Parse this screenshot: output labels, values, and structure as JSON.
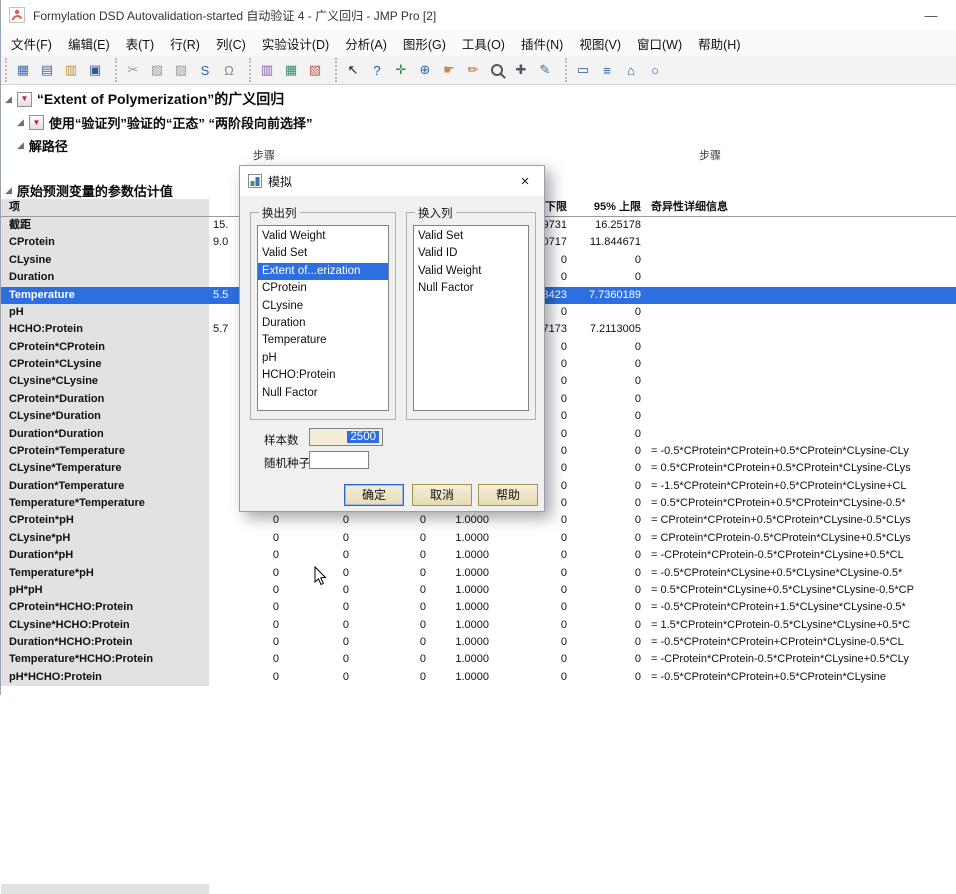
{
  "window": {
    "title": "Formylation DSD Autovalidation-started 自动验证 4 - 广义回归 - JMP Pro [2]",
    "controls": {
      "minimize": "—"
    }
  },
  "menu_bar": {
    "items": [
      "文件(F)",
      "编辑(E)",
      "表(T)",
      "行(R)",
      "列(C)",
      "实验设计(D)",
      "分析(A)",
      "图形(G)",
      "工具(O)",
      "插件(N)",
      "视图(V)",
      "窗口(W)",
      "帮助(H)"
    ]
  },
  "toolbar": {
    "groups": [
      [
        {
          "name": "new-data-table-icon",
          "glyph": "▦",
          "color": "#3f6fb5"
        },
        {
          "name": "new-journal-icon",
          "glyph": "▤",
          "color": "#3f6fb5"
        },
        {
          "name": "open-icon",
          "glyph": "▥",
          "color": "#c29336"
        },
        {
          "name": "save-icon",
          "glyph": "▣",
          "color": "#33568f"
        }
      ],
      [
        {
          "name": "cut-icon",
          "glyph": "✂",
          "color": "#9a9a9a"
        },
        {
          "name": "copy-icon",
          "glyph": "▧",
          "color": "#9a9a9a"
        },
        {
          "name": "paste-icon",
          "glyph": "▨",
          "color": "#9a9a9a"
        },
        {
          "name": "copy-special-icon",
          "glyph": "S",
          "color": "#2e62a8"
        },
        {
          "name": "lock-icon",
          "glyph": "Ω",
          "color": "#8a8a8a"
        }
      ],
      [
        {
          "name": "journal-icon",
          "glyph": "▥",
          "color": "#8b5ca8"
        },
        {
          "name": "layout-icon",
          "glyph": "▦",
          "color": "#2f8f6f"
        },
        {
          "name": "graph-builder-icon",
          "glyph": "▧",
          "color": "#c0574a"
        }
      ],
      [
        {
          "name": "arrow-cursor-icon",
          "glyph": "↖",
          "color": "#1a1a1a"
        },
        {
          "name": "help-tool-icon",
          "glyph": "?",
          "color": "#1b52b5"
        },
        {
          "name": "move-tool-icon",
          "glyph": "✛",
          "color": "#2a8a3a"
        },
        {
          "name": "globe-icon",
          "glyph": "⊕",
          "color": "#2a6ab0"
        },
        {
          "name": "grabber-hand-icon",
          "glyph": "☛",
          "color": "#c8894a"
        },
        {
          "name": "brush-icon",
          "glyph": "✏",
          "color": "#b06a2a"
        },
        {
          "name": "magnifier-icon",
          "glyph": "",
          "color": "#555",
          "cls": "magnifier"
        },
        {
          "name": "plus-icon",
          "glyph": "✚",
          "color": "#556"
        },
        {
          "name": "pencil-icon",
          "glyph": "✎",
          "color": "#2a6ab0"
        }
      ],
      [
        {
          "name": "rectangle-annotate-icon",
          "glyph": "▭",
          "color": "#2a5a9a"
        },
        {
          "name": "lines-annotate-icon",
          "glyph": "≡",
          "color": "#2a5a9a"
        },
        {
          "name": "polygon-annotate-icon",
          "glyph": "⌂",
          "color": "#2a5a9a"
        },
        {
          "name": "oval-annotate-icon",
          "glyph": "○",
          "color": "#2a5a9a"
        }
      ]
    ]
  },
  "report": {
    "outline1": "“Extent of Polymerization”的广义回归",
    "outline2": "使用“验证列”验证的“正态” “两阶段向前选择”",
    "outline3": "解路径",
    "outline4": "原始预测变量的参数估计值",
    "step_label_left": "步骤",
    "step_label_right": "步骤"
  },
  "table": {
    "headers": {
      "term": "项",
      "lower": "下限",
      "upper": "95% 上限",
      "singularity": "奇异性详细信息"
    },
    "rows": [
      {
        "term": "截距",
        "peek": "15.",
        "lower": "9731",
        "upper": "16.25178"
      },
      {
        "term": "CProtein",
        "peek": "9.0",
        "lower": "0717",
        "upper": "11.844671"
      },
      {
        "term": "CLysine",
        "lower": "0",
        "upper": "0"
      },
      {
        "term": "Duration",
        "lower": "0",
        "upper": "0"
      },
      {
        "term": "Temperature",
        "peek": "5.5",
        "lower": "3423",
        "upper": "7.7360189",
        "selected": true
      },
      {
        "term": "pH",
        "lower": "0",
        "upper": "0"
      },
      {
        "term": "HCHO:Protein",
        "peek": "5.7",
        "lower": "7173",
        "upper": "7.2113005"
      },
      {
        "term": "CProtein*CProtein",
        "lower": "0",
        "upper": "0"
      },
      {
        "term": "CProtein*CLysine",
        "lower": "0",
        "upper": "0"
      },
      {
        "term": "CLysine*CLysine",
        "lower": "0",
        "upper": "0"
      },
      {
        "term": "CProtein*Duration",
        "lower": "0",
        "upper": "0"
      },
      {
        "term": "CLysine*Duration",
        "lower": "0",
        "upper": "0"
      },
      {
        "term": "Duration*Duration",
        "lower": "0",
        "upper": "0"
      },
      {
        "term": "CProtein*Temperature",
        "lower": "0",
        "upper": "0",
        "sing": "= -0.5*CProtein*CProtein+0.5*CProtein*CLysine-CLy"
      },
      {
        "term": "CLysine*Temperature",
        "lower": "0",
        "upper": "0",
        "sing": "= 0.5*CProtein*CProtein+0.5*CProtein*CLysine-CLys"
      },
      {
        "term": "Duration*Temperature",
        "lower": "0",
        "upper": "0",
        "sing": "= -1.5*CProtein*CProtein+0.5*CProtein*CLysine+CL"
      },
      {
        "term": "Temperature*Temperature",
        "lower": "0",
        "upper": "0",
        "sing": "= 0.5*CProtein*CProtein+0.5*CProtein*CLysine-0.5*"
      },
      {
        "term": "CProtein*pH",
        "est": "0",
        "se": "0",
        "wald": "0",
        "prob": "1.0000",
        "lower": "0",
        "upper": "0",
        "sing": "= CProtein*CProtein+0.5*CProtein*CLysine-0.5*CLys"
      },
      {
        "term": "CLysine*pH",
        "est": "0",
        "se": "0",
        "wald": "0",
        "prob": "1.0000",
        "lower": "0",
        "upper": "0",
        "sing": "= CProtein*CProtein-0.5*CProtein*CLysine+0.5*CLys"
      },
      {
        "term": "Duration*pH",
        "est": "0",
        "se": "0",
        "wald": "0",
        "prob": "1.0000",
        "lower": "0",
        "upper": "0",
        "sing": "= -CProtein*CProtein-0.5*CProtein*CLysine+0.5*CL"
      },
      {
        "term": "Temperature*pH",
        "est": "0",
        "se": "0",
        "wald": "0",
        "prob": "1.0000",
        "lower": "0",
        "upper": "0",
        "sing": "= -0.5*CProtein*CLysine+0.5*CLysine*CLysine-0.5*"
      },
      {
        "term": "pH*pH",
        "est": "0",
        "se": "0",
        "wald": "0",
        "prob": "1.0000",
        "lower": "0",
        "upper": "0",
        "sing": "= 0.5*CProtein*CLysine+0.5*CLysine*CLysine-0.5*CP"
      },
      {
        "term": "CProtein*HCHO:Protein",
        "est": "0",
        "se": "0",
        "wald": "0",
        "prob": "1.0000",
        "lower": "0",
        "upper": "0",
        "sing": "= -0.5*CProtein*CProtein+1.5*CLysine*CLysine-0.5*"
      },
      {
        "term": "CLysine*HCHO:Protein",
        "est": "0",
        "se": "0",
        "wald": "0",
        "prob": "1.0000",
        "lower": "0",
        "upper": "0",
        "sing": "= 1.5*CProtein*CProtein-0.5*CLysine*CLysine+0.5*C"
      },
      {
        "term": "Duration*HCHO:Protein",
        "est": "0",
        "se": "0",
        "wald": "0",
        "prob": "1.0000",
        "lower": "0",
        "upper": "0",
        "sing": "= -0.5*CProtein*CProtein+CProtein*CLysine-0.5*CL"
      },
      {
        "term": "Temperature*HCHO:Protein",
        "est": "0",
        "se": "0",
        "wald": "0",
        "prob": "1.0000",
        "lower": "0",
        "upper": "0",
        "sing": "= -CProtein*CProtein-0.5*CProtein*CLysine+0.5*CLy"
      },
      {
        "term": "pH*HCHO:Protein",
        "est": "0",
        "se": "0",
        "wald": "0",
        "prob": "1.0000",
        "lower": "0",
        "upper": "0",
        "sing": "= -0.5*CProtein*CProtein+0.5*CProtein*CLysine"
      }
    ]
  },
  "dialog": {
    "title": "模拟",
    "close_glyph": "×",
    "switch_out": {
      "label": "换出列",
      "items": [
        "Valid Weight",
        "Valid Set",
        "Extent of...erization",
        "CProtein",
        "CLysine",
        "Duration",
        "Temperature",
        "pH",
        "HCHO:Protein",
        "Null Factor"
      ],
      "selected_index": 2
    },
    "switch_in": {
      "label": "换入列",
      "items": [
        "Valid Set",
        "Valid ID",
        "Valid Weight",
        "Null Factor"
      ]
    },
    "sample_count_label": "样本数",
    "sample_count_value": "2500",
    "random_seed_label": "随机种子",
    "buttons": {
      "ok": "确定",
      "cancel": "取消",
      "help": "帮助"
    }
  }
}
